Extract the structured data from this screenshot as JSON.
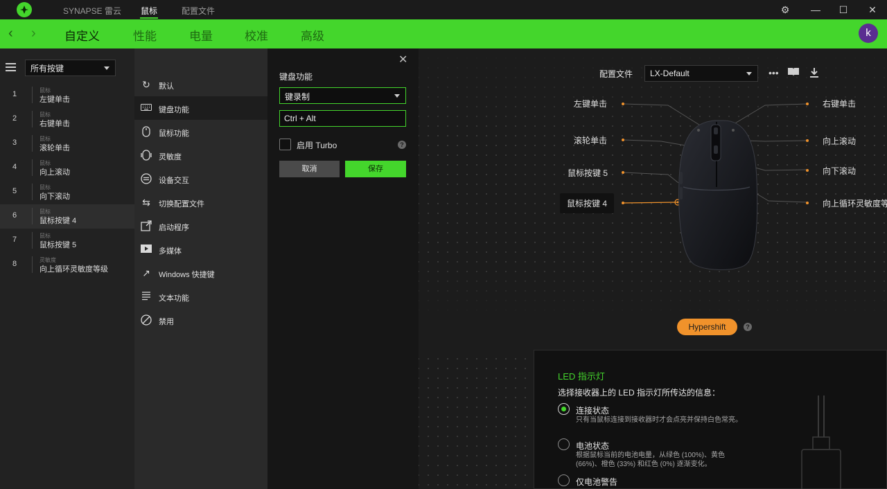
{
  "titlebar": {
    "tabs": [
      "SYNAPSE 雷云",
      "鼠标",
      "配置文件"
    ],
    "active_tab": "鼠标"
  },
  "nav": {
    "tabs": [
      "自定义",
      "性能",
      "电量",
      "校准",
      "高级"
    ],
    "active_tab": "自定义",
    "avatar": "k"
  },
  "left": {
    "filter": "所有按键",
    "buttons": [
      {
        "num": "1",
        "category": "鼠标",
        "label": "左键单击"
      },
      {
        "num": "2",
        "category": "鼠标",
        "label": "右键单击"
      },
      {
        "num": "3",
        "category": "鼠标",
        "label": "滚轮单击"
      },
      {
        "num": "4",
        "category": "鼠标",
        "label": "向上滚动"
      },
      {
        "num": "5",
        "category": "鼠标",
        "label": "向下滚动"
      },
      {
        "num": "6",
        "category": "鼠标",
        "label": "鼠标按键 4"
      },
      {
        "num": "7",
        "category": "鼠标",
        "label": "鼠标按键 5"
      },
      {
        "num": "8",
        "category": "灵敏度",
        "label": "向上循环灵敏度等级"
      }
    ],
    "selected_index": 5
  },
  "functions": {
    "items": [
      {
        "icon": "reset-icon",
        "label": "默认"
      },
      {
        "icon": "keyboard-icon",
        "label": "键盘功能"
      },
      {
        "icon": "mouse-icon",
        "label": "鼠标功能"
      },
      {
        "icon": "sensitivity-icon",
        "label": "灵敏度"
      },
      {
        "icon": "device-interaction-icon",
        "label": "设备交互"
      },
      {
        "icon": "switch-profile-icon",
        "label": "切换配置文件"
      },
      {
        "icon": "launch-program-icon",
        "label": "启动程序"
      },
      {
        "icon": "multimedia-icon",
        "label": "多媒体"
      },
      {
        "icon": "windows-shortcut-icon",
        "label": "Windows 快捷键"
      },
      {
        "icon": "text-function-icon",
        "label": "文本功能"
      },
      {
        "icon": "disable-icon",
        "label": "禁用"
      }
    ],
    "selected_index": 1
  },
  "editor": {
    "title": "键盘功能",
    "mode": "键录制",
    "key_value": "Ctrl + Alt",
    "turbo_label": "启用 Turbo",
    "turbo_checked": false,
    "cancel": "取消",
    "save": "保存"
  },
  "profile": {
    "label": "配置文件",
    "value": "LX-Default"
  },
  "mapping": {
    "left": [
      "左键单击",
      "滚轮单击",
      "鼠标按键 5",
      "鼠标按键 4"
    ],
    "right": [
      "右键单击",
      "向上滚动",
      "向下滚动",
      "向上循环灵敏度等"
    ]
  },
  "hypershift": "Hypershift",
  "led": {
    "title": "LED 指示灯",
    "desc": "选择接收器上的 LED 指示灯所传达的信息：",
    "options": [
      {
        "title": "连接状态",
        "desc": "只有当鼠标连接到接收器时才会点亮并保持白色常亮。",
        "selected": true
      },
      {
        "title": "电池状态",
        "desc": "根据鼠标当前的电池电量，从绿色 (100%)、黄色 (66%)、橙色 (33%) 和红色 (0%) 逐渐变化。",
        "selected": false
      },
      {
        "title": "仅电池警告",
        "desc": "",
        "selected": false
      }
    ]
  },
  "colors": {
    "accent": "#44d62c",
    "hypershift": "#f0922b",
    "avatar": "#5a2d91"
  }
}
